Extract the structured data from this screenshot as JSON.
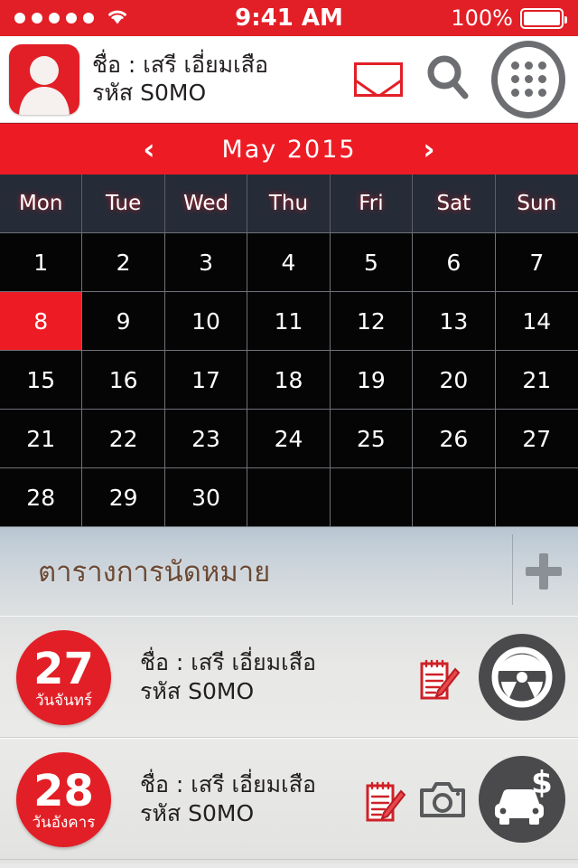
{
  "status_bar": {
    "signal_dots": 5,
    "wifi_icon": "wifi-icon",
    "time": "9:41 AM",
    "battery_percent": "100%",
    "battery_icon": "battery-full-icon"
  },
  "header": {
    "avatar_icon": "avatar-placeholder",
    "name_line": "ชื่อ : เสรี เอี่ยมเสือ",
    "code_line": "รหัส S0MO",
    "mail_icon": "envelope-icon",
    "search_icon": "search-icon",
    "menu_icon": "grid-menu-icon"
  },
  "calendar": {
    "prev_label": "‹",
    "next_label": "›",
    "month_label": "May 2015",
    "weekdays": [
      "Mon",
      "Tue",
      "Wed",
      "Thu",
      "Fri",
      "Sat",
      "Sun"
    ],
    "selected_day": "8",
    "weeks": [
      [
        "1",
        "2",
        "3",
        "4",
        "5",
        "6",
        "7"
      ],
      [
        "8",
        "9",
        "10",
        "11",
        "12",
        "13",
        "14"
      ],
      [
        "15",
        "16",
        "17",
        "18",
        "19",
        "20",
        "21"
      ],
      [
        "21",
        "22",
        "23",
        "24",
        "25",
        "26",
        "27"
      ],
      [
        "28",
        "29",
        "30",
        "",
        "",
        "",
        ""
      ]
    ]
  },
  "appointments": {
    "section_title": "ตารางการนัดหมาย",
    "add_icon": "plus-icon",
    "rows": [
      {
        "day_number": "27",
        "day_name": "วันจันทร์",
        "name_line": "ชื่อ : เสรี เอี่ยมเสือ",
        "code_line": "รหัส S0MO",
        "actions": [
          "note-edit-icon",
          "steering-wheel-icon"
        ]
      },
      {
        "day_number": "28",
        "day_name": "วันอังคาร",
        "name_line": "ชื่อ : เสรี เอี่ยมเสือ",
        "code_line": "รหัส S0MO",
        "actions": [
          "note-edit-icon",
          "camera-icon",
          "car-dollar-icon"
        ]
      }
    ]
  },
  "colors": {
    "brand_red": "#e21f26",
    "bar_red": "#ed1c24",
    "weekday_bg": "#262b38",
    "calendar_bg": "#050505",
    "icon_gray": "#6d6e71",
    "title_brown": "#6b4a35"
  }
}
